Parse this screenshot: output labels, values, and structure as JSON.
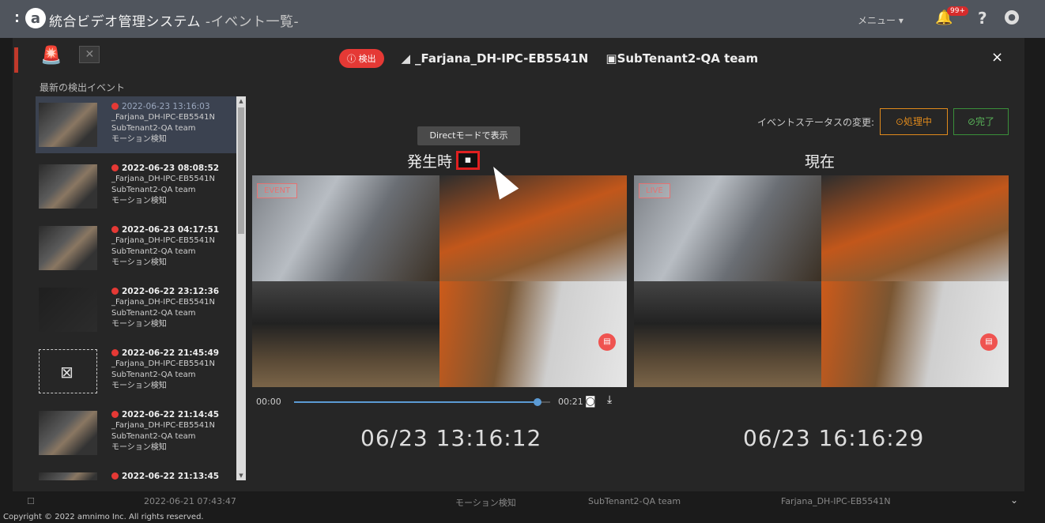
{
  "app": {
    "logo_letter": "a",
    "title": "統合ビデオ管理システム",
    "subtitle": " -イベント一覧-",
    "menu_label": "メニュー ▾",
    "notif_count": "99+",
    "help": "?",
    "user_icon": "user-icon"
  },
  "sidebar": {
    "heading": "最新の検出イベント",
    "events": [
      {
        "datetime": "2022-06-23 13:16:03",
        "camera": "_Farjana_DH-IPC-EB5541N",
        "tenant": "SubTenant2-QA team",
        "type": "モーション検知"
      },
      {
        "datetime": "2022-06-23 08:08:52",
        "camera": "_Farjana_DH-IPC-EB5541N",
        "tenant": "SubTenant2-QA team",
        "type": "モーション検知"
      },
      {
        "datetime": "2022-06-23 04:17:51",
        "camera": "_Farjana_DH-IPC-EB5541N",
        "tenant": "SubTenant2-QA team",
        "type": "モーション検知"
      },
      {
        "datetime": "2022-06-22 23:12:36",
        "camera": "_Farjana_DH-IPC-EB5541N",
        "tenant": "SubTenant2-QA team",
        "type": "モーション検知"
      },
      {
        "datetime": "2022-06-22 21:45:49",
        "camera": "_Farjana_DH-IPC-EB5541N",
        "tenant": "SubTenant2-QA team",
        "type": "モーション検知"
      },
      {
        "datetime": "2022-06-22 21:14:45",
        "camera": "_Farjana_DH-IPC-EB5541N",
        "tenant": "SubTenant2-QA team",
        "type": "モーション検知"
      },
      {
        "datetime": "2022-06-22 21:13:45",
        "camera": "",
        "tenant": "",
        "type": ""
      }
    ]
  },
  "header": {
    "detect_label": "検出",
    "camera": "_Farjana_DH-IPC-EB5541N",
    "tenant": "SubTenant2-QA team",
    "close": "×"
  },
  "status": {
    "label": "イベントステータスの変更:",
    "processing": "処理中",
    "done": "完了"
  },
  "tooltip": "Directモードで表示",
  "occurrence": {
    "title": "発生時",
    "tag": "EVENT",
    "time_start": "00:00",
    "time_end": "00:21",
    "progress": 0.95,
    "timestamp": "06/23 13:16:12"
  },
  "current": {
    "title": "現在",
    "tag": "LIVE",
    "timestamp": "06/23 16:16:29"
  },
  "bottom_row": {
    "datetime": "2022-06-21 07:43:47",
    "type": "モーション検知",
    "tenant": "SubTenant2-QA team",
    "camera": "Farjana_DH-IPC-EB5541N"
  },
  "footer": {
    "copyright": "Copyright © 2022 amnimo Inc. All rights reserved."
  },
  "colors": {
    "accent_red": "#e53935",
    "processing": "#e08a1c",
    "done": "#3a8f3a",
    "seek": "#5b9bd5"
  }
}
